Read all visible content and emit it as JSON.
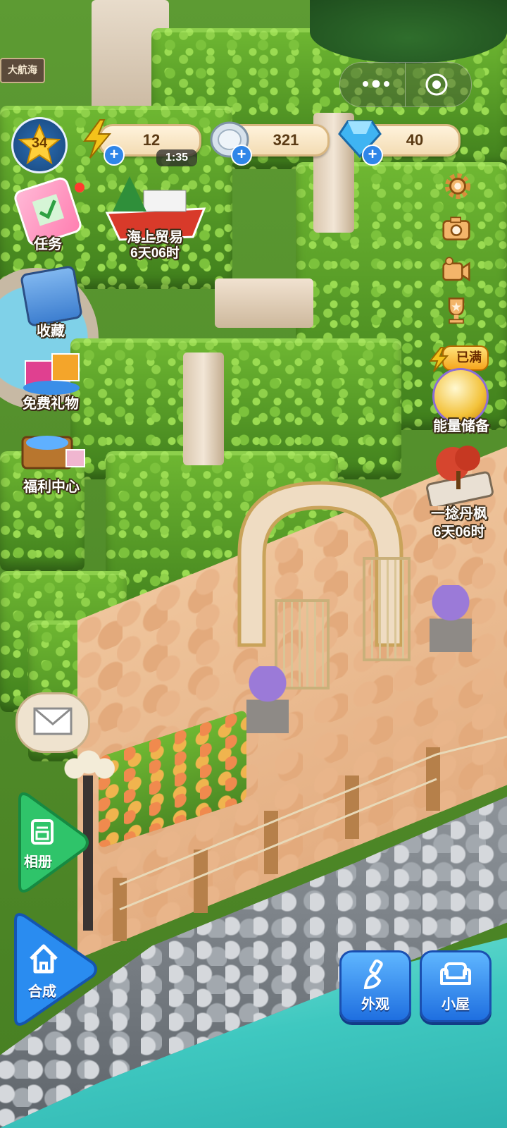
{
  "hud": {
    "level": "34",
    "energy": "12",
    "energy_timer": "1:35",
    "coins": "321",
    "gems": "40",
    "colors": {
      "energy": "#f4c21a",
      "plus": "#2f86e8",
      "pill": "#fff3dc"
    }
  },
  "miniprogram": {
    "more_icon": "more-dots-icon",
    "close_icon": "target-close-icon"
  },
  "left_menu": {
    "sign": "大航海",
    "tasks": "任务",
    "sea_trade": "海上贸易",
    "sea_trade_timer": "6天06时",
    "favorites": "收藏",
    "free_gifts": "免费礼物",
    "welfare": "福利中心"
  },
  "right_menu": {
    "settings_icon": "gear-icon",
    "camera_icon": "camera-icon",
    "video_icon": "video-camera-icon",
    "trophy_icon": "trophy-icon",
    "energy_badge": "已满",
    "energy_storage": "能量储备",
    "maple_event": "一捻丹枫",
    "maple_timer": "6天06时"
  },
  "bottom": {
    "album": "相册",
    "merge": "合成",
    "exterior": "外观",
    "cabin": "小屋",
    "mail_icon": "envelope-icon"
  }
}
